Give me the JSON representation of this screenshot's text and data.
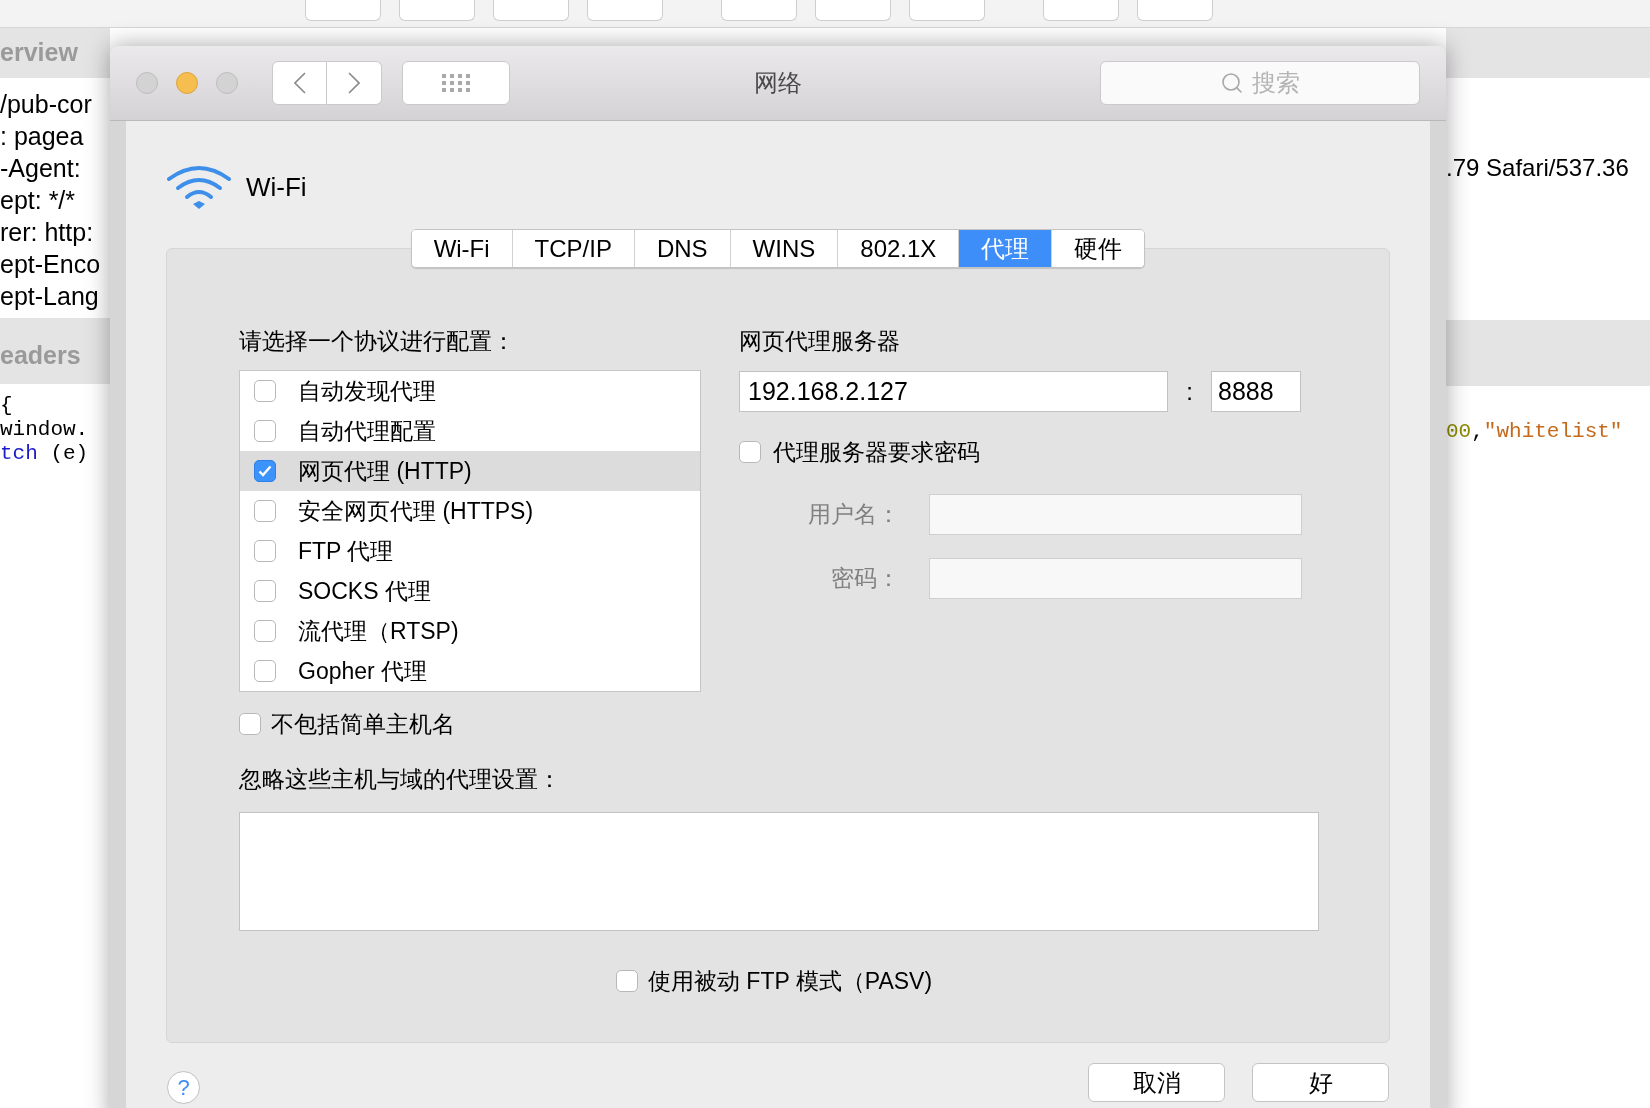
{
  "background_app": {
    "overview_tab": "erview",
    "header_lines": [
      "/pub-cor",
      ": pagea",
      "-Agent:",
      "ept: */*",
      "rer: http:",
      "ept-Enco",
      "ept-Lang"
    ],
    "headers_tab": "eaders",
    "code_lines": [
      [
        {
          "text": "{",
          "kind": "plain"
        }
      ],
      [
        {
          "text": "window.",
          "kind": "plain"
        }
      ],
      [
        {
          "text": "tch",
          "kind": "keyword"
        },
        {
          "text": " (e)",
          "kind": "plain"
        }
      ]
    ],
    "right_header_line": ".79 Safari/537.36",
    "right_code_line": [
      {
        "text": "00",
        "kind": "number"
      },
      {
        "text": ",",
        "kind": "plain"
      },
      {
        "text": "\"whitelist\"",
        "kind": "string"
      }
    ]
  },
  "window": {
    "title": "网络",
    "search": {
      "placeholder": "搜索"
    }
  },
  "interface": {
    "name": "Wi-Fi"
  },
  "tabs": [
    {
      "label": "Wi-Fi",
      "selected": false
    },
    {
      "label": "TCP/IP",
      "selected": false
    },
    {
      "label": "DNS",
      "selected": false
    },
    {
      "label": "WINS",
      "selected": false
    },
    {
      "label": "802.1X",
      "selected": false
    },
    {
      "label": "代理",
      "selected": true
    },
    {
      "label": "硬件",
      "selected": false
    }
  ],
  "protocols": {
    "heading": "请选择一个协议进行配置：",
    "items": [
      {
        "label": "自动发现代理",
        "checked": false,
        "selected": false
      },
      {
        "label": "自动代理配置",
        "checked": false,
        "selected": false
      },
      {
        "label": "网页代理 (HTTP)",
        "checked": true,
        "selected": true
      },
      {
        "label": "安全网页代理 (HTTPS)",
        "checked": false,
        "selected": false
      },
      {
        "label": "FTP 代理",
        "checked": false,
        "selected": false
      },
      {
        "label": "SOCKS 代理",
        "checked": false,
        "selected": false
      },
      {
        "label": "流代理（RTSP)",
        "checked": false,
        "selected": false
      },
      {
        "label": "Gopher 代理",
        "checked": false,
        "selected": false
      }
    ]
  },
  "exclude_simple_hostnames": {
    "label": "不包括简单主机名",
    "checked": false
  },
  "bypass": {
    "heading": "忽略这些主机与域的代理设置："
  },
  "passive_ftp": {
    "label": "使用被动 FTP 模式（PASV)",
    "checked": false
  },
  "proxy_server": {
    "heading": "网页代理服务器",
    "host": "192.168.2.127",
    "separator": ":",
    "port": "8888",
    "requires_password": {
      "label": "代理服务器要求密码",
      "checked": false
    },
    "username_label": "用户名：",
    "password_label": "密码："
  },
  "help_button": "?",
  "buttons": {
    "cancel": "取消",
    "ok": "好"
  }
}
